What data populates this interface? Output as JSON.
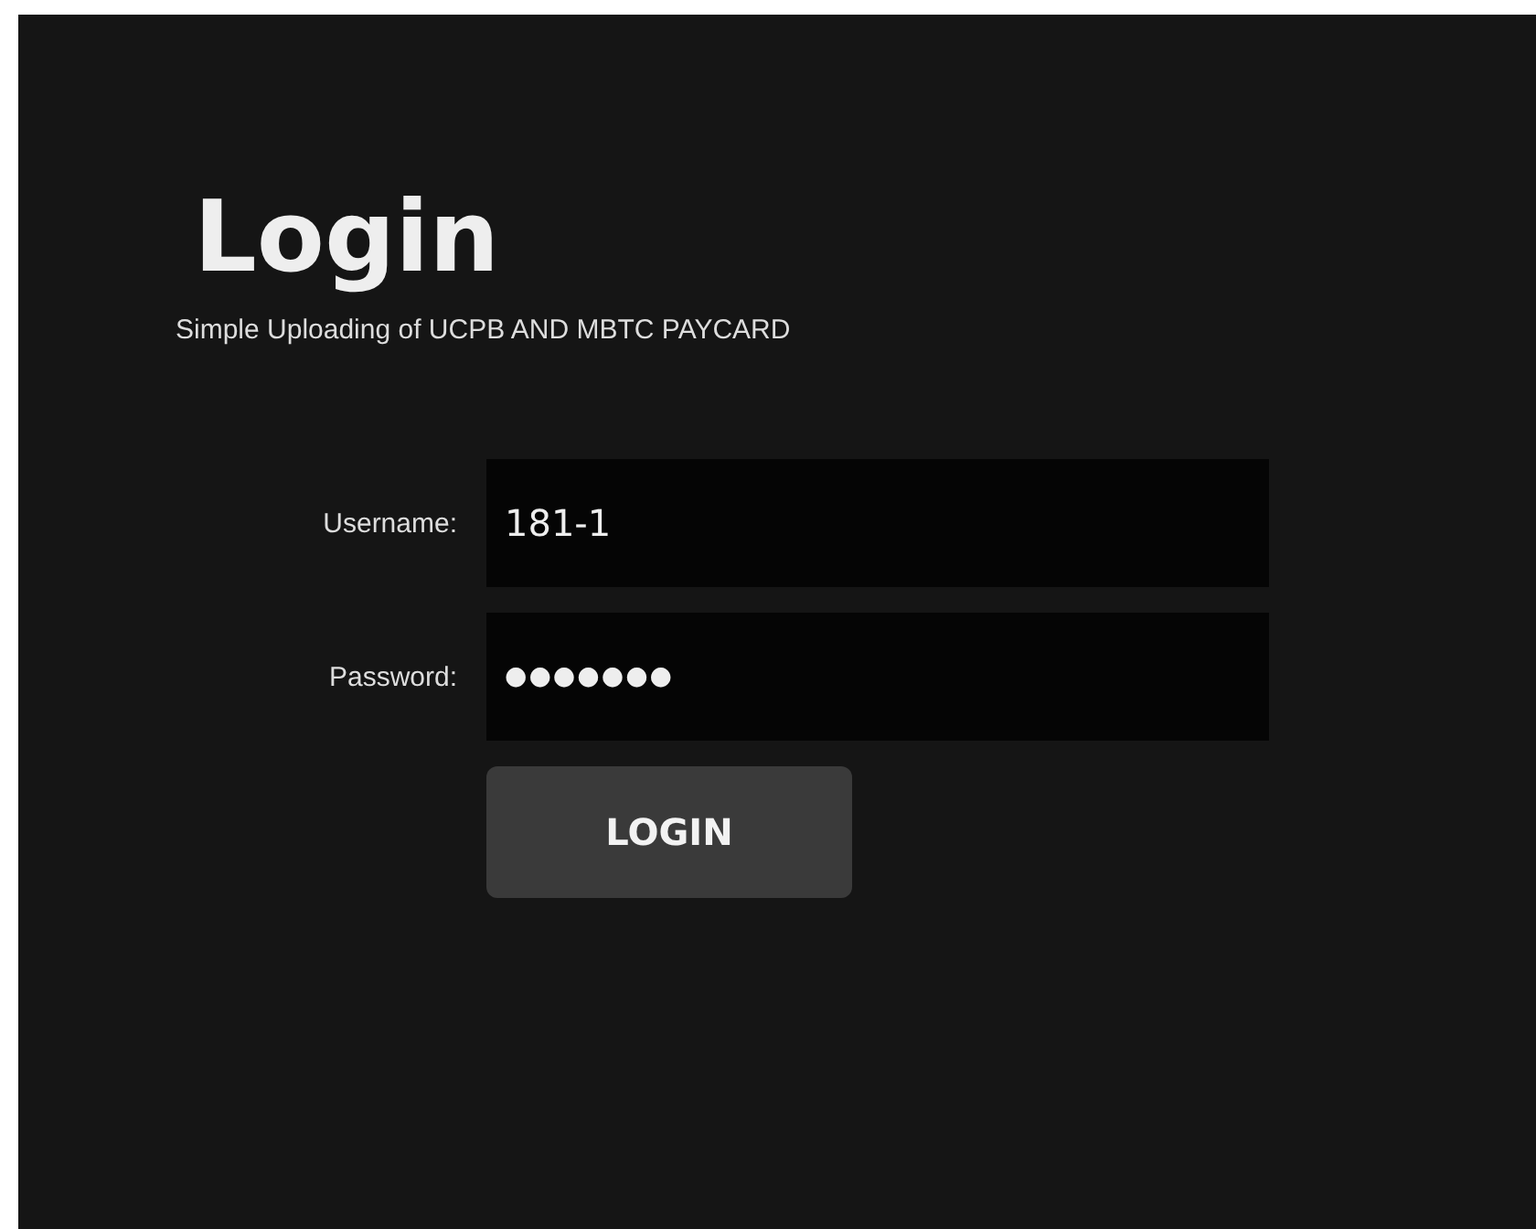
{
  "title": "Login",
  "subtitle": "Simple Uploading of UCPB AND MBTC PAYCARD",
  "fields": [
    {
      "label": "Username:",
      "value": "181-1",
      "kind": "text"
    },
    {
      "label": "Password:",
      "value": "●●●●●●●",
      "kind": "password"
    }
  ],
  "button": "LOGIN"
}
